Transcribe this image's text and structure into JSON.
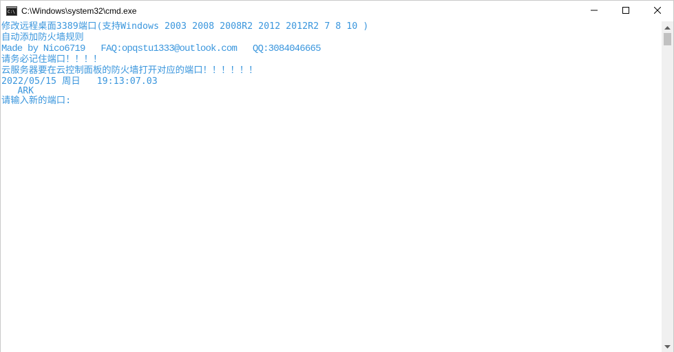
{
  "window": {
    "title": "C:\\Windows\\system32\\cmd.exe",
    "app_icon": "cmd-console-icon",
    "controls": {
      "minimize_icon": "minimize-icon",
      "maximize_icon": "maximize-icon",
      "close_icon": "close-icon"
    }
  },
  "console": {
    "text_color": "#3a96dd",
    "background": "#ffffff",
    "lines": [
      "修改远程桌面3389端口(支持Windows 2003 2008 2008R2 2012 2012R2 7 8 10 )",
      "自动添加防火墙规则",
      "Made by Nico6719   FAQ:opqstu1333@outlook.com   QQ:3084046665",
      "请务必记住端口！！！！",
      "云服务器要在云控制面板的防火墙打开对应的端口！！！！！！",
      "2022/05/15 周日   19:13:07.03",
      "   ARK",
      "请输入新的端口:"
    ]
  },
  "scrollbar": {
    "up_icon": "scroll-up-arrow-icon",
    "down_icon": "scroll-down-arrow-icon"
  }
}
